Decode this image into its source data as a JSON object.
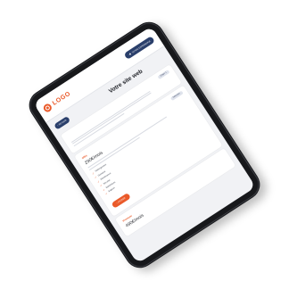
{
  "header": {
    "logo_text": "LOGO",
    "top_button_label": "VOTRE EXPERIENCE"
  },
  "titlebar": {
    "back_label": "RETOUR",
    "title": "Votre site web"
  },
  "intro_card": {
    "badge": "Étape 1"
  },
  "offer_card": {
    "section_label": "Offre",
    "price": "290€/mois",
    "badge": "Sélection",
    "features": [
      "Hébergement",
      "Domaine",
      "Maintenance",
      "Sécurité",
      "Statistiques",
      "Support"
    ],
    "cta_label": "CHOISIR"
  },
  "second_card": {
    "section_label": "Premium",
    "price": "490€/mois"
  },
  "colors": {
    "accent": "#ea5a2a",
    "navy": "#2a3f6b",
    "frame": "#17181b"
  }
}
